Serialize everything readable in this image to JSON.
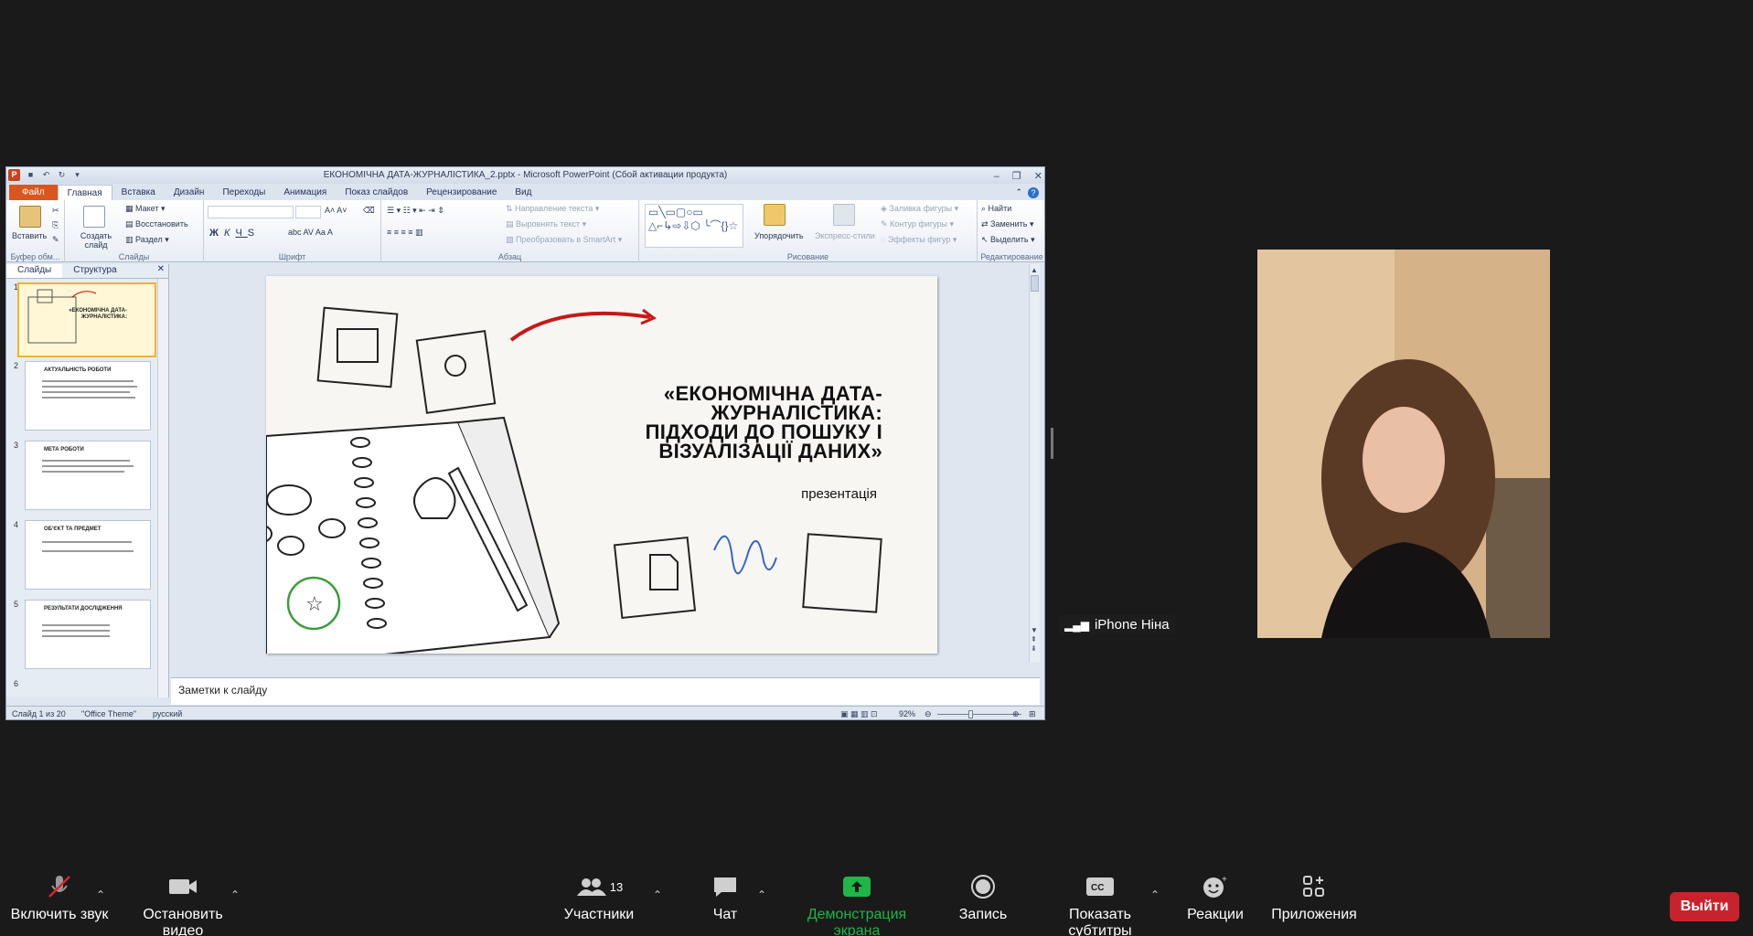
{
  "ppt": {
    "title": "ЕКОНОМІЧНА ДАТА-ЖУРНАЛІСТИКА_2.pptx - Microsoft PowerPoint (Сбой активации продукта)",
    "tabs": [
      "Файл",
      "Главная",
      "Вставка",
      "Дизайн",
      "Переходы",
      "Анимация",
      "Показ слайдов",
      "Рецензирование",
      "Вид"
    ],
    "ribbon": {
      "paste": "Вставить",
      "clipboard_group": "Буфер обм...",
      "create_slide": "Создать слайд",
      "layout": "Макет",
      "reset": "Восстановить",
      "section": "Раздел",
      "slides_group": "Слайды",
      "font_group": "Шрифт",
      "text_direction": "Направление текста",
      "align_text": "Выровнять текст",
      "smartart": "Преобразовать в SmartArt",
      "paragraph_group": "Абзац",
      "arrange": "Упорядочить",
      "quick_styles": "Экспресс-стили",
      "shape_fill": "Заливка фигуры",
      "shape_outline": "Контур фигуры",
      "shape_effects": "Эффекты фигур",
      "drawing_group": "Рисование",
      "find": "Найти",
      "replace": "Заменить",
      "select": "Выделить",
      "editing_group": "Редактирование"
    },
    "pane_tabs": [
      "Слайды",
      "Структура"
    ],
    "thumbnails": [
      {
        "num": "1",
        "title": "«ЕКОНОМІЧНА ДАТА-ЖУРНАЛІСТИКА»"
      },
      {
        "num": "2",
        "title": "АКТУАЛЬНІСТЬ РОБОТИ"
      },
      {
        "num": "3",
        "title": "МЕТА РОБОТИ"
      },
      {
        "num": "4",
        "title": "ОБ'ЄКТ ТА ПРЕДМЕТ"
      },
      {
        "num": "5",
        "title": "РЕЗУЛЬТАТИ ДОСЛІДЖЕННЯ"
      },
      {
        "num": "6",
        "title": ""
      }
    ],
    "slide": {
      "title": "«ЕКОНОМІЧНА ДАТА-ЖУРНАЛІСТИКА: ПІДХОДИ ДО ПОШУКУ І ВІЗУАЛІЗАЦІЇ ДАНИХ»",
      "title_lines": [
        "«ЕКОНОМІЧНА ДАТА-",
        "ЖУРНАЛІСТИКА:",
        "ПІДХОДИ ДО ПОШУКУ І",
        "ВІЗУАЛІЗАЦІЇ ДАНИХ»"
      ],
      "subtitle": "презентація"
    },
    "notes_placeholder": "Заметки к слайду",
    "status": {
      "slide_counter": "Слайд 1 из 20",
      "theme": "\"Office Theme\"",
      "language": "русский",
      "zoom": "92%"
    }
  },
  "zoom": {
    "participant_label": "iPhone Ніна",
    "toolbar": {
      "mute": "Включить звук",
      "video": "Остановить видео",
      "participants": "Участники",
      "participants_count": "13",
      "chat": "Чат",
      "share": "Демонстрация экрана",
      "record": "Запись",
      "captions": "Показать субтитры",
      "reactions": "Реакции",
      "apps": "Приложения",
      "leave": "Выйти"
    },
    "colors": {
      "share": "#1fb547",
      "leave": "#c8232c"
    }
  }
}
